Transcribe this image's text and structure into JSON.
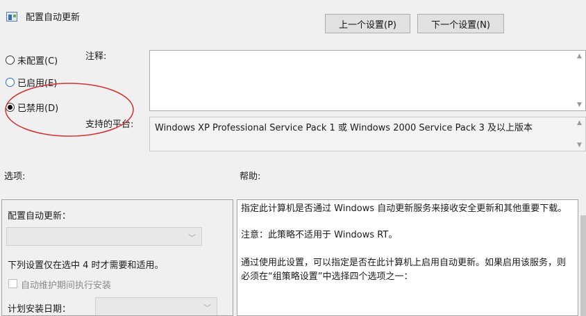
{
  "header": {
    "title": "配置自动更新",
    "prev_button": "上一个设置(P)",
    "next_button": "下一个设置(N)"
  },
  "state": {
    "options": [
      {
        "label": "未配置(C)",
        "selected": false
      },
      {
        "label": "已启用(E)",
        "selected": false
      },
      {
        "label": "已禁用(D)",
        "selected": true
      }
    ],
    "annotation_color": "#d23030"
  },
  "comment": {
    "label": "注释:",
    "value": ""
  },
  "platform": {
    "label": "支持的平台:",
    "value": "Windows XP Professional Service Pack 1 或 Windows 2000 Service Pack 3 及以上版本"
  },
  "options_section": {
    "heading": "选项:",
    "configure_label": "配置自动更新：",
    "combo_value": "",
    "note": "下列设置仅在选中 4 时才需要和适用。",
    "maintenance_checkbox_label": "自动维护期间执行安装",
    "schedule_day_label": "计划安装日期：",
    "schedule_day_value": ""
  },
  "help_section": {
    "heading": "帮助:",
    "paragraphs": [
      "指定此计算机是否通过 Windows 自动更新服务来接收安全更新和其他重要下载。",
      "注意：此策略不适用于 Windows RT。",
      "通过使用此设置，可以指定是否在此计算机上启用自动更新。如果启用该服务，则必须在“组策略设置”中选择四个选项之一："
    ]
  }
}
